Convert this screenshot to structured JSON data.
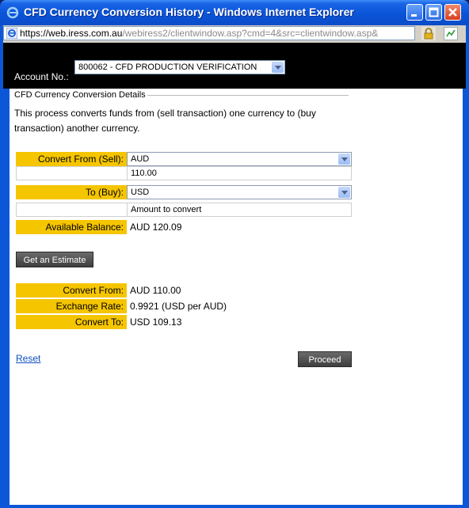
{
  "window": {
    "title": "CFD Currency Conversion History - Windows Internet Explorer"
  },
  "address": {
    "scheme": "https://",
    "host": "web.iress.com.au",
    "rest": "/webiress2/clientwindow.asp?cmd=4&src=clientwindow.asp&"
  },
  "account": {
    "label": "Account No.:",
    "selected": "800062 - CFD PRODUCTION VERIFICATION"
  },
  "form": {
    "legend": "CFD Currency Conversion Details",
    "description": "This process converts funds from (sell transaction) one currency to (buy transaction) another currency.",
    "convert_from_label": "Convert From (Sell):",
    "convert_from_value": "AUD",
    "amount_value": "110.00",
    "to_label": "To (Buy):",
    "to_value": "USD",
    "amount_placeholder": "Amount to convert",
    "available_label": "Available Balance:",
    "available_value": "AUD 120.09",
    "estimate_button": "Get an Estimate"
  },
  "estimate": {
    "from_label": "Convert From:",
    "from_value": "AUD 110.00",
    "rate_label": "Exchange Rate:",
    "rate_value": "0.9921 (USD per AUD)",
    "to_label": "Convert To:",
    "to_value": "USD 109.13"
  },
  "actions": {
    "reset": "Reset",
    "proceed": "Proceed"
  }
}
